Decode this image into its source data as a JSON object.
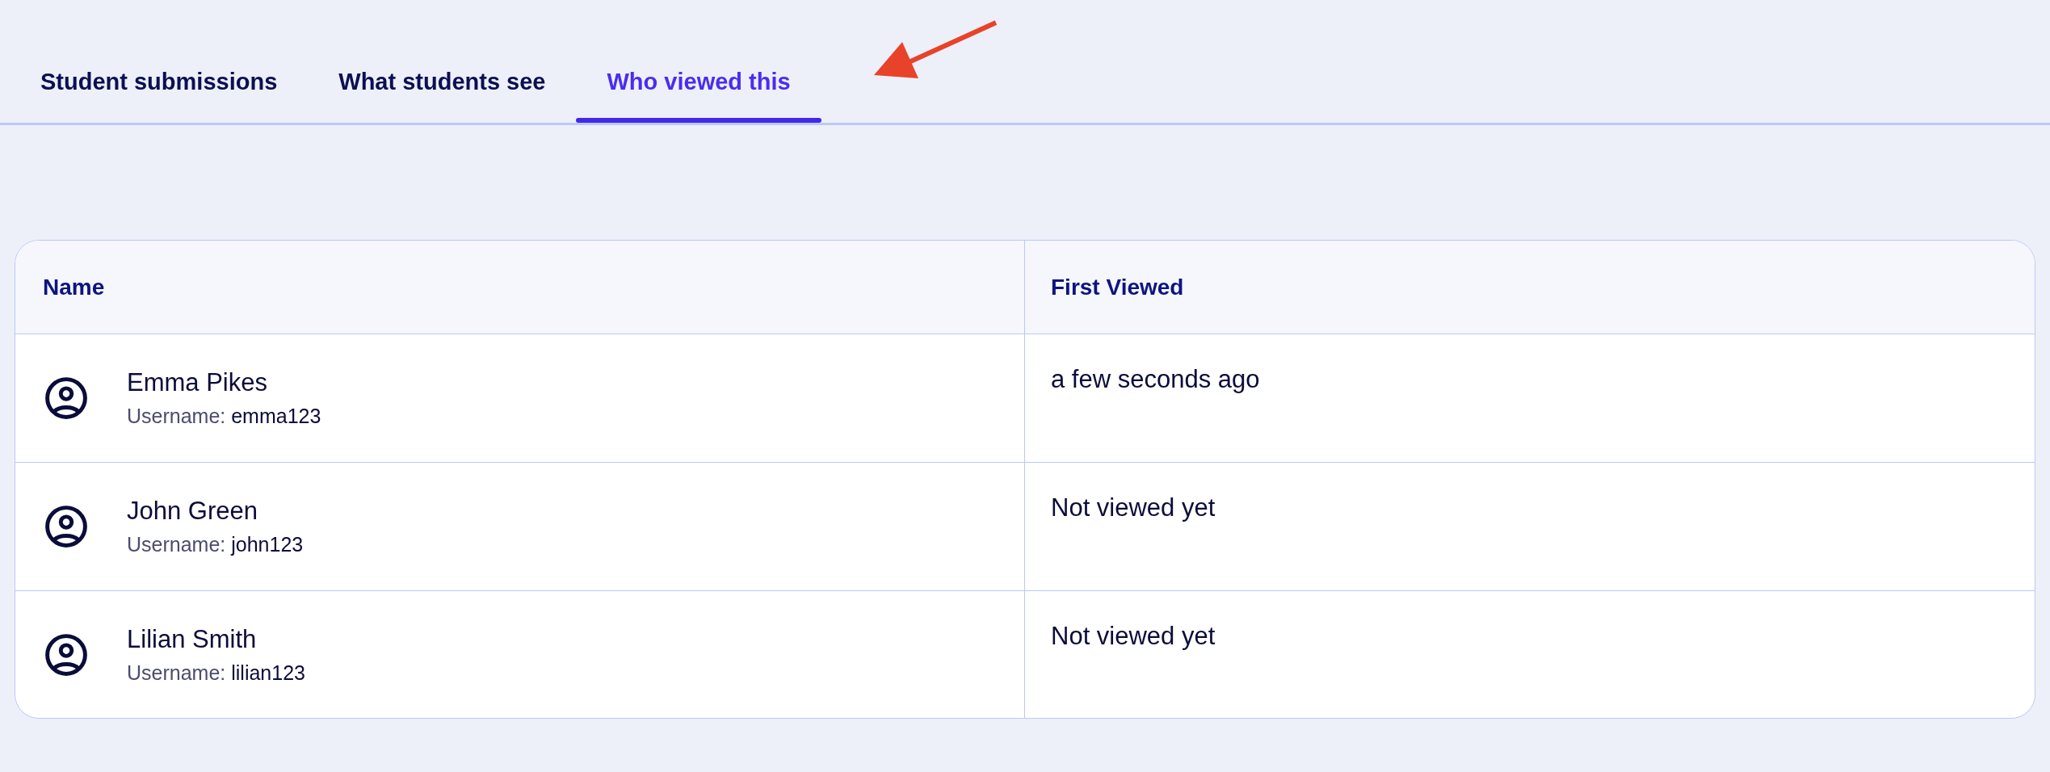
{
  "tabs": [
    {
      "label": "Student submissions",
      "selected": false
    },
    {
      "label": "What students see",
      "selected": false
    },
    {
      "label": "Who viewed this",
      "selected": true
    }
  ],
  "table": {
    "columns": [
      "Name",
      "First Viewed"
    ],
    "rows": [
      {
        "name": "Emma Pikes",
        "username_label": "Username:",
        "username": "emma123",
        "first_viewed": "a few seconds ago"
      },
      {
        "name": "John Green",
        "username_label": "Username:",
        "username": "john123",
        "first_viewed": "Not viewed yet"
      },
      {
        "name": "Lilian Smith",
        "username_label": "Username:",
        "username": "lilian123",
        "first_viewed": "Not viewed yet"
      }
    ]
  }
}
